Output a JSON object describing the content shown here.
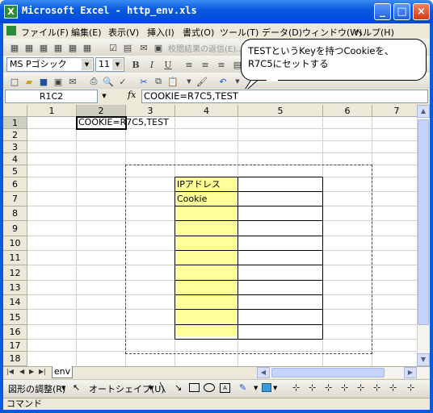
{
  "window": {
    "title": "Microsoft Excel - http_env.xls",
    "app_icon": "X",
    "minimize": "_",
    "maximize": "□",
    "close": "×"
  },
  "menu": {
    "items": [
      "ファイル(F)",
      "編集(E)",
      "表示(V)",
      "挿入(I)",
      "書式(O)",
      "ツール(T)",
      "データ(D)",
      "ウィンドウ(W)",
      "ヘルプ(H)"
    ]
  },
  "toolbar": {
    "review_label": "校閲結果の返信(E)...",
    "font_name": "MS Pゴシック",
    "font_size": "11"
  },
  "callout": {
    "line1": "TESTというKeyを持つCookieを、",
    "line2": "R7C5にセットする"
  },
  "formula_bar": {
    "name_box": "R1C2",
    "fx": "fx",
    "formula": "COOKIE=R7C5,TEST"
  },
  "grid": {
    "columns": [
      "1",
      "2",
      "3",
      "4",
      "5",
      "6",
      "7"
    ],
    "rows": [
      "1",
      "2",
      "3",
      "4",
      "5",
      "6",
      "7",
      "8",
      "9",
      "10",
      "11",
      "12",
      "13",
      "14",
      "15",
      "16",
      "17",
      "18"
    ],
    "selected_cell_text": "COOKIE=R7C5,TEST",
    "table_labels": [
      "IPアドレス",
      "Cookie"
    ]
  },
  "sheet": {
    "tab": "env"
  },
  "drawing_toolbar": {
    "draw_menu": "図形の調整(R)",
    "autoshape_menu": "オートシェイプ(U)"
  },
  "status": {
    "text": "コマンド"
  }
}
